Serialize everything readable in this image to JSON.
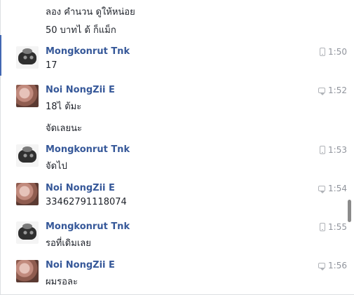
{
  "conversation": {
    "top_lines": [
      "ลอง คำนวน ดูให้หน่อย",
      "50 บาทไ ด้ ก็แม็ก"
    ],
    "messages": [
      {
        "sender": "Mongkonrut Tnk",
        "avatar": "mongkonrut-avatar",
        "time_icon": "mobile-icon",
        "time": "1:50",
        "text": "17",
        "extra": ""
      },
      {
        "sender": "Noi NongZii E",
        "avatar": "noi-avatar",
        "time_icon": "chat-icon",
        "time": "1:52",
        "text": "18ไ ต้มะ",
        "extra": "จัดเลยนะ"
      },
      {
        "sender": "Mongkonrut Tnk",
        "avatar": "mongkonrut-avatar",
        "time_icon": "mobile-icon",
        "time": "1:53",
        "text": "จัดไป",
        "extra": ""
      },
      {
        "sender": "Noi NongZii E",
        "avatar": "noi-avatar",
        "time_icon": "chat-icon",
        "time": "1:54",
        "text": "33462791118074",
        "extra": ""
      },
      {
        "sender": "Mongkonrut Tnk",
        "avatar": "mongkonrut-avatar",
        "time_icon": "mobile-icon",
        "time": "1:55",
        "text": "รอที่เดิมเลย",
        "extra": ""
      },
      {
        "sender": "Noi NongZii E",
        "avatar": "noi-avatar",
        "time_icon": "chat-icon",
        "time": "1:56",
        "text": "ผมรอละ",
        "extra": ""
      }
    ]
  }
}
